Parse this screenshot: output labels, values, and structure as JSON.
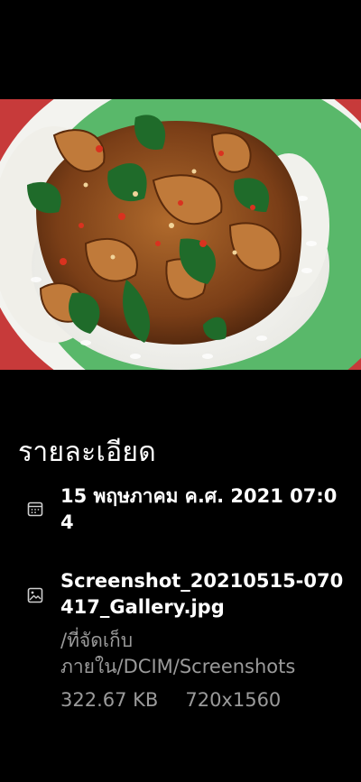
{
  "photo": {
    "subject": "stir-fried basil with rice on a green plate",
    "colors": {
      "background_red": "#c73a3a",
      "plate_green": "#59b86a",
      "plate_white": "#f3f3ef",
      "rice": "#f4f4f1",
      "sauce_brown": "#8a4b1f",
      "basil_green": "#1f6b2a",
      "chili_red": "#d9321f"
    }
  },
  "details": {
    "title": "รายละเอียด",
    "date": {
      "icon": "calendar-icon",
      "value": "15 พฤษภาคม ค.ศ. 2021 07:04"
    },
    "file": {
      "icon": "image-icon",
      "name": "Screenshot_20210515-070417_Gallery.jpg",
      "path": "/ที่จัดเก็บภายใน/DCIM/Screenshots",
      "size": "322.67 KB",
      "resolution": "720x1560"
    }
  }
}
